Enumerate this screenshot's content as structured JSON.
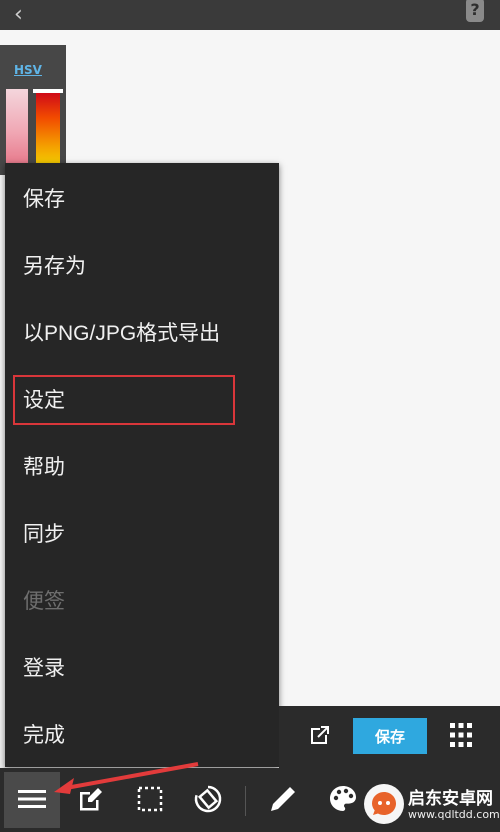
{
  "palette": {
    "tab_label": "HSV"
  },
  "menu": {
    "items": [
      {
        "label": "保存",
        "enabled": true
      },
      {
        "label": "另存为",
        "enabled": true
      },
      {
        "label": "以PNG/JPG格式导出",
        "enabled": true
      },
      {
        "label": "设定",
        "enabled": true,
        "highlighted": true
      },
      {
        "label": "帮助",
        "enabled": true
      },
      {
        "label": "同步",
        "enabled": true
      },
      {
        "label": "便签",
        "enabled": false
      },
      {
        "label": "登录",
        "enabled": true
      },
      {
        "label": "完成",
        "enabled": true
      }
    ]
  },
  "subbar": {
    "save_label": "保存"
  },
  "toolbar": {
    "icons": [
      "menu-icon",
      "edit-icon",
      "selection-icon",
      "rotate-icon",
      "pencil-icon",
      "palette-icon"
    ]
  },
  "watermark": {
    "title": "启东安卓网",
    "url": "www.qdltdd.com"
  },
  "colors": {
    "accent": "#2fa8df",
    "highlight": "#d9363a",
    "menu_bg": "#262626"
  }
}
